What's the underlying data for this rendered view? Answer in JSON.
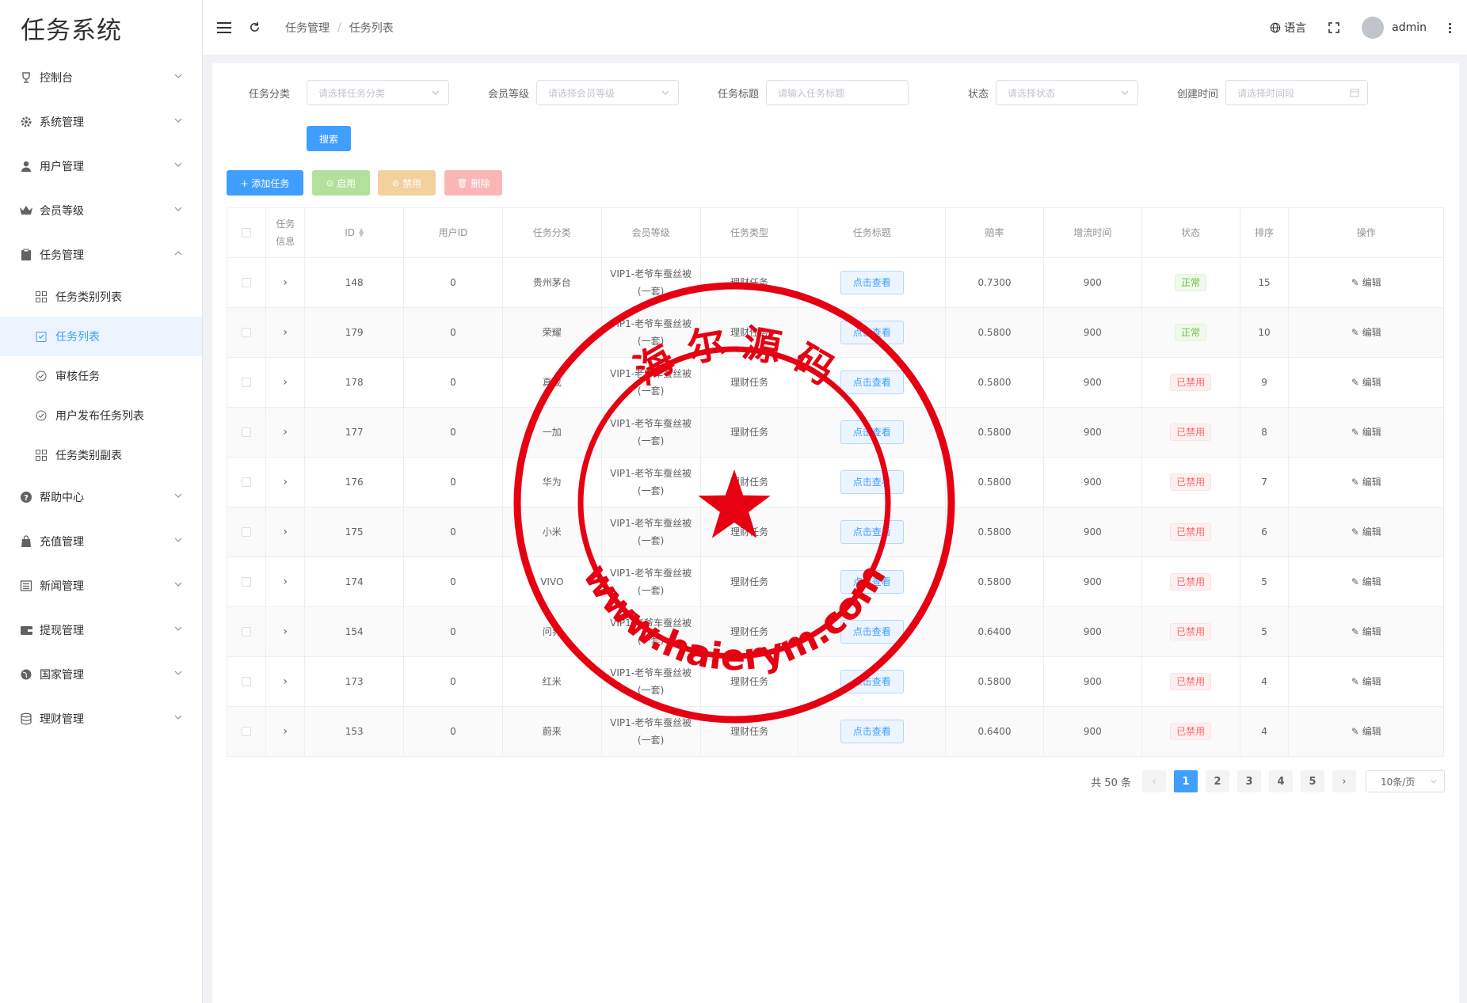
{
  "app": {
    "title": "任务系统"
  },
  "sidebar": {
    "items": [
      {
        "label": "控制台",
        "icon": "trophy-icon"
      },
      {
        "label": "系统管理",
        "icon": "gear-icon"
      },
      {
        "label": "用户管理",
        "icon": "user-icon"
      },
      {
        "label": "会员等级",
        "icon": "crown-icon"
      },
      {
        "label": "任务管理",
        "icon": "clipboard-icon",
        "expanded": true
      }
    ],
    "subitems": [
      {
        "label": "任务类别列表",
        "icon": "grid-icon"
      },
      {
        "label": "任务列表",
        "icon": "clipboard-check-icon",
        "active": true
      },
      {
        "label": "审核任务",
        "icon": "check-circle-icon"
      },
      {
        "label": "用户发布任务列表",
        "icon": "check-circle-icon"
      },
      {
        "label": "任务类别副表",
        "icon": "grid-icon"
      }
    ],
    "items2": [
      {
        "label": "帮助中心",
        "icon": "question-icon"
      },
      {
        "label": "充值管理",
        "icon": "bag-icon"
      },
      {
        "label": "新闻管理",
        "icon": "news-icon"
      },
      {
        "label": "提现管理",
        "icon": "wallet-icon"
      },
      {
        "label": "国家管理",
        "icon": "globe-icon"
      },
      {
        "label": "理财管理",
        "icon": "database-icon"
      }
    ]
  },
  "header": {
    "breadcrumb": [
      "任务管理",
      "任务列表"
    ],
    "language": "语言",
    "username": "admin"
  },
  "filters": {
    "category_label": "任务分类",
    "category_placeholder": "请选择任务分类",
    "level_label": "会员等级",
    "level_placeholder": "请选择会员等级",
    "title_label": "任务标题",
    "title_placeholder": "请输入任务标题",
    "status_label": "状态",
    "status_placeholder": "请选择状态",
    "created_label": "创建时间",
    "created_placeholder": "请选择时间段",
    "search_button": "搜索"
  },
  "toolbar": {
    "add": "+ 添加任务",
    "enable": "启用",
    "disable": "禁用",
    "delete": "删除"
  },
  "table": {
    "columns": [
      "任务\n信息",
      "ID",
      "用户ID",
      "任务分类",
      "会员等级",
      "任务类型",
      "任务标题",
      "赔率",
      "增流时间",
      "状态",
      "排序",
      "操作"
    ],
    "view_label": "点击查看",
    "edit_label": "编辑",
    "rows": [
      {
        "id": "148",
        "uid": "0",
        "category": "贵州茅台",
        "level": "VIP1-老爷车蚕丝被\n(一套)",
        "type": "理财任务",
        "odds": "0.7300",
        "time": "900",
        "status": "正常",
        "ok": true,
        "sort": "15"
      },
      {
        "id": "179",
        "uid": "0",
        "category": "荣耀",
        "level": "VIP1-老爷车蚕丝被\n(一套)",
        "type": "理财任务",
        "odds": "0.5800",
        "time": "900",
        "status": "正常",
        "ok": true,
        "sort": "10"
      },
      {
        "id": "178",
        "uid": "0",
        "category": "真我",
        "level": "VIP1-老爷车蚕丝被\n(一套)",
        "type": "理财任务",
        "odds": "0.5800",
        "time": "900",
        "status": "已禁用",
        "ok": false,
        "sort": "9"
      },
      {
        "id": "177",
        "uid": "0",
        "category": "一加",
        "level": "VIP1-老爷车蚕丝被\n(一套)",
        "type": "理财任务",
        "odds": "0.5800",
        "time": "900",
        "status": "已禁用",
        "ok": false,
        "sort": "8"
      },
      {
        "id": "176",
        "uid": "0",
        "category": "华为",
        "level": "VIP1-老爷车蚕丝被\n(一套)",
        "type": "理财任务",
        "odds": "0.5800",
        "time": "900",
        "status": "已禁用",
        "ok": false,
        "sort": "7"
      },
      {
        "id": "175",
        "uid": "0",
        "category": "小米",
        "level": "VIP1-老爷车蚕丝被\n(一套)",
        "type": "理财任务",
        "odds": "0.5800",
        "time": "900",
        "status": "已禁用",
        "ok": false,
        "sort": "6"
      },
      {
        "id": "174",
        "uid": "0",
        "category": "VIVO",
        "level": "VIP1-老爷车蚕丝被\n(一套)",
        "type": "理财任务",
        "odds": "0.5800",
        "time": "900",
        "status": "已禁用",
        "ok": false,
        "sort": "5"
      },
      {
        "id": "154",
        "uid": "0",
        "category": "问界",
        "level": "VIP1-老爷车蚕丝被\n(一套)",
        "type": "理财任务",
        "odds": "0.6400",
        "time": "900",
        "status": "已禁用",
        "ok": false,
        "sort": "5"
      },
      {
        "id": "173",
        "uid": "0",
        "category": "红米",
        "level": "VIP1-老爷车蚕丝被\n(一套)",
        "type": "理财任务",
        "odds": "0.5800",
        "time": "900",
        "status": "已禁用",
        "ok": false,
        "sort": "4"
      },
      {
        "id": "153",
        "uid": "0",
        "category": "蔚来",
        "level": "VIP1-老爷车蚕丝被\n(一套)",
        "type": "理财任务",
        "odds": "0.6400",
        "time": "900",
        "status": "已禁用",
        "ok": false,
        "sort": "4"
      }
    ]
  },
  "pagination": {
    "total": "共 50 条",
    "pages": [
      "1",
      "2",
      "3",
      "4",
      "5"
    ],
    "current": "1",
    "page_size": "10条/页"
  },
  "watermark": {
    "top_text": "海 尔 源 码",
    "bottom_text": "www.haierym.com",
    "color": "#e60012"
  },
  "colors": {
    "primary": "#409eff",
    "success": "#67c23a",
    "warning": "#e6a23c",
    "danger": "#f56c6c"
  }
}
